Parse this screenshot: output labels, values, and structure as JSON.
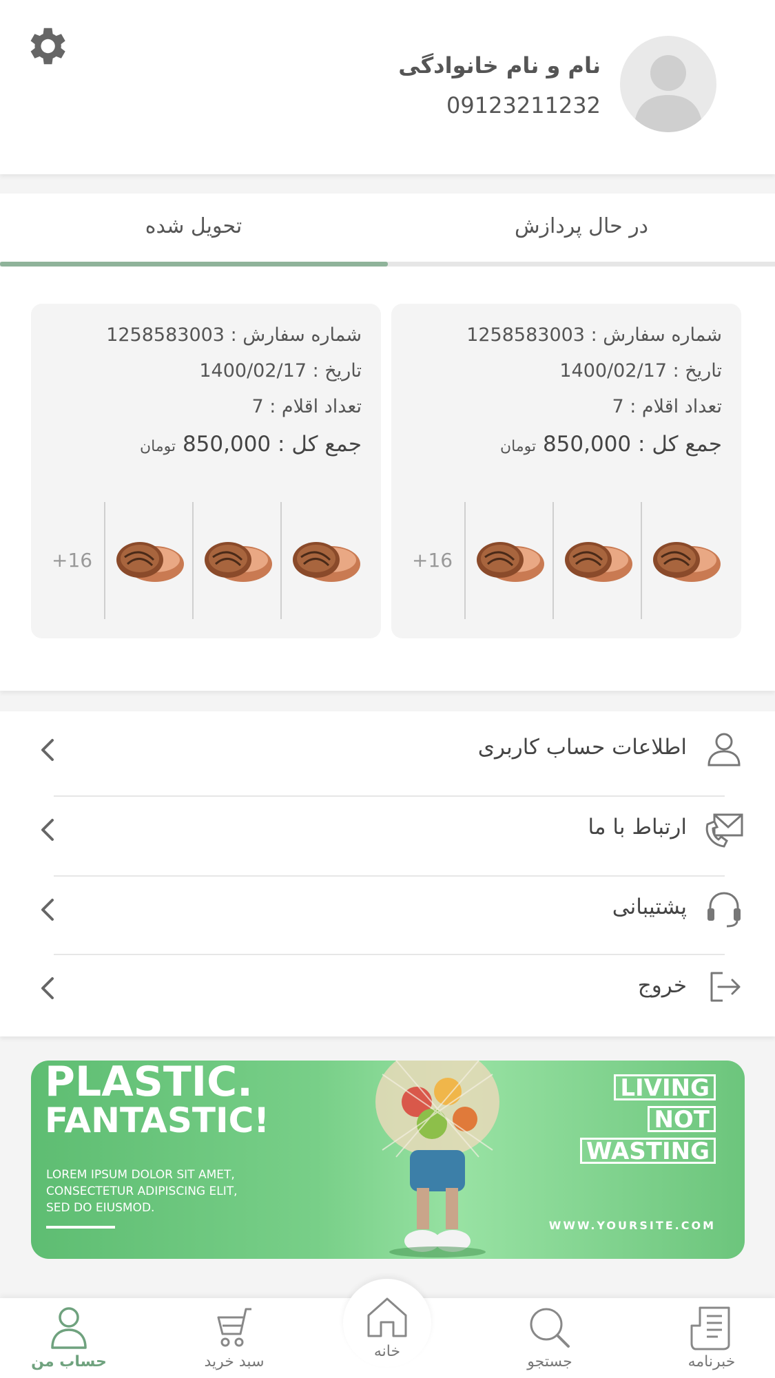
{
  "header": {
    "user_name": "نام و نام خانوادگی",
    "phone": "09123211232"
  },
  "orders": {
    "tabs": [
      "در حال پردازش",
      "تحویل شده"
    ],
    "active_tab": "تحویل شده",
    "cards": [
      {
        "order_number": "شماره سفارش : 1258583003",
        "date": "تاریخ : 1400/02/17",
        "item_count": "تعداد اقلام : 7",
        "total_label": "جمع کل :",
        "total_value": "850,000",
        "currency": "تومان",
        "more_count": "+16"
      },
      {
        "order_number": "شماره سفارش : 1258583003",
        "date": "تاریخ : 1400/02/17",
        "item_count": "تعداد اقلام : 7",
        "total_label": "جمع کل :",
        "total_value": "850,000",
        "currency": "تومان",
        "more_count": "+16"
      }
    ]
  },
  "menu": {
    "items": [
      {
        "label": "اطلاعات حساب کاربری",
        "icon": "user-icon"
      },
      {
        "label": "ارتباط با ما",
        "icon": "mail-phone-icon"
      },
      {
        "label": "پشتیبانی",
        "icon": "headset-icon"
      },
      {
        "label": "خروج",
        "icon": "logout-icon"
      }
    ]
  },
  "banner": {
    "headline_1": "PLASTIC.",
    "headline_2": "FANTASTIC!",
    "body_1": "LOREM IPSUM DOLOR SIT AMET,",
    "body_2": "CONSECTETUR ADIPISCING ELIT,",
    "body_3": "SED DO EIUSMOD.",
    "right_1": "LIVING",
    "right_2": "NOT",
    "right_3": "WASTING",
    "url": "WWW.YOURSITE.COM"
  },
  "bottom_nav": {
    "items": [
      {
        "label": "حساب من",
        "icon": "account-icon",
        "active": true
      },
      {
        "label": "سبد خرید",
        "icon": "cart-icon"
      },
      {
        "label": "خانه",
        "icon": "home-icon"
      },
      {
        "label": "جستجو",
        "icon": "search-icon"
      },
      {
        "label": "خبرنامه",
        "icon": "newsletter-icon"
      }
    ]
  },
  "colors": {
    "accent": "#8fb39a",
    "active_nav": "#6fa27e",
    "banner_green": "#6cc57c"
  }
}
